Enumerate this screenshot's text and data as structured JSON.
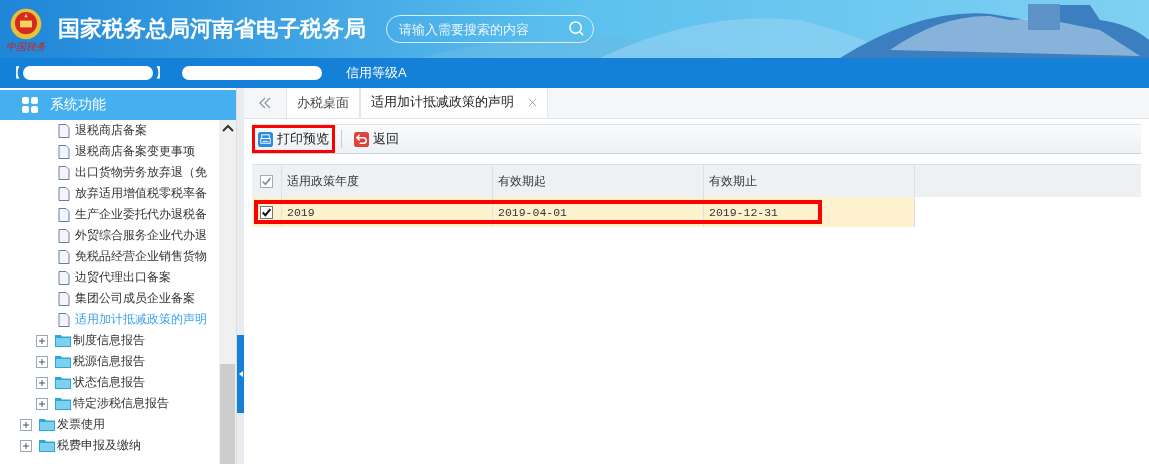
{
  "header": {
    "title": "国家税务总局河南省电子税务局",
    "logo_caption": "中国税务",
    "search": {
      "placeholder": "请输入需要搜索的内容"
    }
  },
  "account_bar": {
    "open_bracket": "【",
    "close_bracket": "】",
    "credit": "信用等级A"
  },
  "sidebar": {
    "title": "系统功能",
    "tree": [
      {
        "children": [
          {
            "children": [
              {
                "kind": "doc",
                "label": "退税商店备案",
                "selected": false
              },
              {
                "kind": "doc",
                "label": "退税商店备案变更事项",
                "selected": false
              },
              {
                "kind": "doc",
                "label": "出口货物劳务放弃退（免",
                "selected": false
              },
              {
                "kind": "doc",
                "label": "放弃适用增值税零税率备",
                "selected": false
              },
              {
                "kind": "doc",
                "label": "生产企业委托代办退税备",
                "selected": false
              },
              {
                "kind": "doc",
                "label": "外贸综合服务企业代办退",
                "selected": false
              },
              {
                "kind": "doc",
                "label": "免税品经营企业销售货物",
                "selected": false
              },
              {
                "kind": "doc",
                "label": "边贸代理出口备案",
                "selected": false
              },
              {
                "kind": "doc",
                "label": "集团公司成员企业备案",
                "selected": false
              },
              {
                "kind": "doc",
                "label": "适用加计抵减政策的声明",
                "selected": true
              }
            ]
          },
          {
            "kind": "folder",
            "label": "制度信息报告",
            "expanded": false
          },
          {
            "kind": "folder",
            "label": "税源信息报告",
            "expanded": false
          },
          {
            "kind": "folder",
            "label": "状态信息报告",
            "expanded": false
          },
          {
            "kind": "folder",
            "label": "特定涉税信息报告",
            "expanded": false
          }
        ]
      },
      {
        "kind": "folder",
        "label": "发票使用",
        "expanded": false
      },
      {
        "kind": "folder",
        "label": "税费申报及缴纳",
        "expanded": false
      }
    ]
  },
  "tabs": [
    {
      "label": "办税桌面",
      "selected": false,
      "closable": false
    },
    {
      "label": "适用加计抵减政策的声明",
      "selected": true,
      "closable": true
    }
  ],
  "toolbar": [
    {
      "kind": "print",
      "label": "打印预览",
      "highlighted": true
    },
    {
      "kind": "back",
      "label": "返回",
      "highlighted": false
    }
  ],
  "table": {
    "all_checked": true,
    "columns": [
      "适用政策年度",
      "有效期起",
      "有效期止"
    ],
    "rows": [
      {
        "checked": true,
        "highlighted": true,
        "cells": [
          "2019",
          "2019-04-01",
          "2019-12-31"
        ]
      }
    ]
  }
}
